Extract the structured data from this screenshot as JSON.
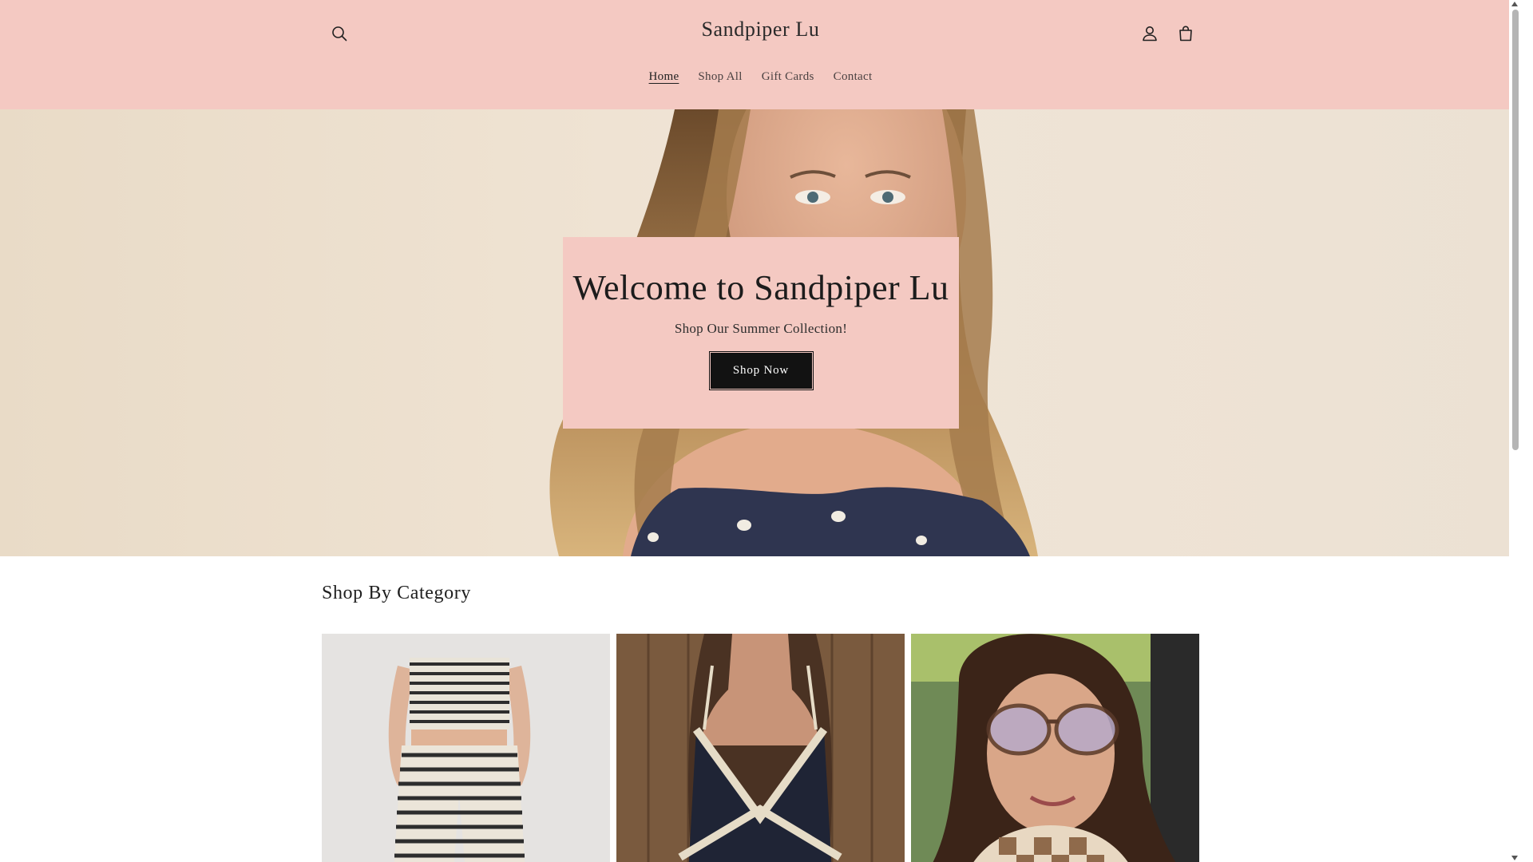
{
  "header": {
    "brand": "Sandpiper Lu",
    "icons": {
      "search": "search-icon",
      "account": "account-icon",
      "cart": "cart-icon"
    },
    "nav": [
      {
        "label": "Home",
        "active": true
      },
      {
        "label": "Shop All",
        "active": false
      },
      {
        "label": "Gift Cards",
        "active": false
      },
      {
        "label": "Contact",
        "active": false
      }
    ],
    "background_color": "#f4c9c2"
  },
  "hero": {
    "title": "Welcome to Sandpiper Lu",
    "subtitle": "Shop Our Summer Collection!",
    "button_label": "Shop Now",
    "card_color": "#f4c9c2",
    "button_color": "#121212"
  },
  "categories": {
    "title": "Shop By Category"
  }
}
